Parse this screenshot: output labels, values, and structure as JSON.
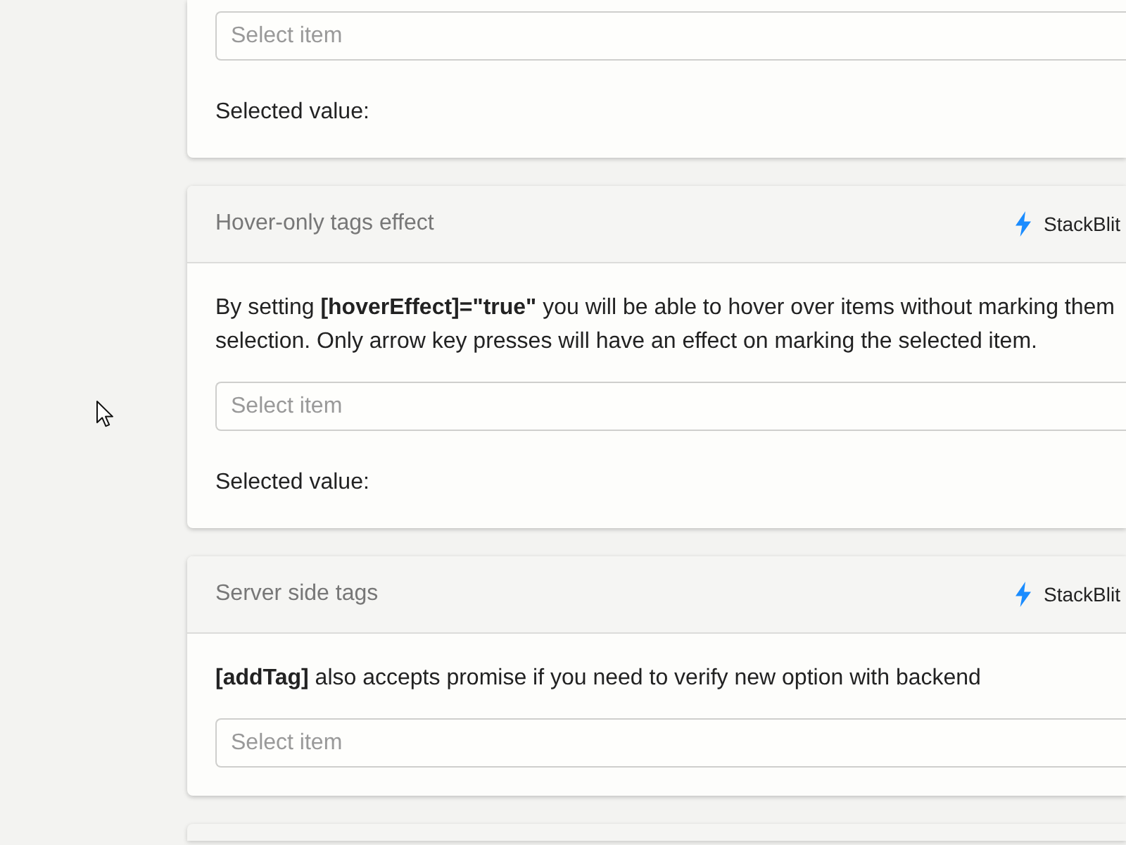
{
  "cards": [
    {
      "kind": "continued",
      "select": {
        "placeholder": "Select item"
      },
      "selected_value_label": "Selected value:"
    },
    {
      "kind": "full",
      "title": "Hover-only tags effect",
      "link": "StackBlit",
      "description": [
        "By setting **[hoverEffect]=\"true\"** you will be able to hover over items without marking them",
        "selection. Only arrow key presses will have an effect on marking the selected item."
      ],
      "select": {
        "placeholder": "Select item"
      },
      "selected_value_label": "Selected value:"
    },
    {
      "kind": "full",
      "title": "Server side tags",
      "link": "StackBlit",
      "description": [
        "**[addTag]** also accepts promise if you need to verify new option with backend"
      ],
      "select": {
        "placeholder": "Select item"
      }
    },
    {
      "kind": "cut"
    }
  ]
}
